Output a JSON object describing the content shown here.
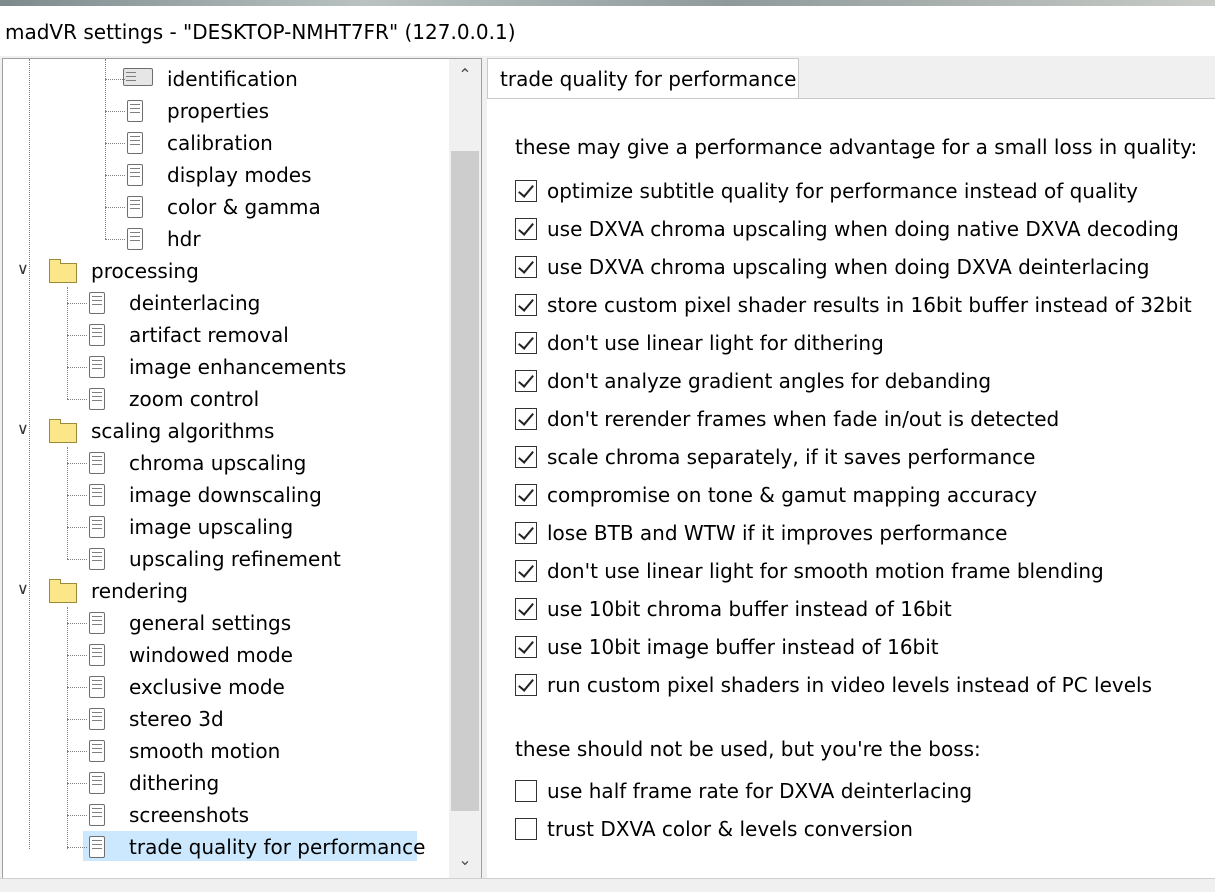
{
  "window": {
    "title": "madVR settings - \"DESKTOP-NMHT7FR\" (127.0.0.1)"
  },
  "tree": {
    "items": [
      {
        "label": "identification",
        "level": 2,
        "icon": "identification-icon"
      },
      {
        "label": "properties",
        "level": 2,
        "icon": "page-icon"
      },
      {
        "label": "calibration",
        "level": 2,
        "icon": "page-icon"
      },
      {
        "label": "display modes",
        "level": 2,
        "icon": "page-icon"
      },
      {
        "label": "color & gamma",
        "level": 2,
        "icon": "page-icon"
      },
      {
        "label": "hdr",
        "level": 2,
        "icon": "page-icon"
      },
      {
        "label": "processing",
        "level": 0,
        "icon": "folder-icon"
      },
      {
        "label": "deinterlacing",
        "level": 1,
        "icon": "page-icon"
      },
      {
        "label": "artifact removal",
        "level": 1,
        "icon": "page-icon"
      },
      {
        "label": "image enhancements",
        "level": 1,
        "icon": "page-icon"
      },
      {
        "label": "zoom control",
        "level": 1,
        "icon": "page-icon"
      },
      {
        "label": "scaling algorithms",
        "level": 0,
        "icon": "folder-icon"
      },
      {
        "label": "chroma upscaling",
        "level": 1,
        "icon": "page-icon"
      },
      {
        "label": "image downscaling",
        "level": 1,
        "icon": "page-icon"
      },
      {
        "label": "image upscaling",
        "level": 1,
        "icon": "page-icon"
      },
      {
        "label": "upscaling refinement",
        "level": 1,
        "icon": "page-icon"
      },
      {
        "label": "rendering",
        "level": 0,
        "icon": "folder-icon"
      },
      {
        "label": "general settings",
        "level": 1,
        "icon": "page-icon"
      },
      {
        "label": "windowed mode",
        "level": 1,
        "icon": "page-icon"
      },
      {
        "label": "exclusive mode",
        "level": 1,
        "icon": "page-icon"
      },
      {
        "label": "stereo 3d",
        "level": 1,
        "icon": "page-icon"
      },
      {
        "label": "smooth motion",
        "level": 1,
        "icon": "page-icon"
      },
      {
        "label": "dithering",
        "level": 1,
        "icon": "page-icon"
      },
      {
        "label": "screenshots",
        "level": 1,
        "icon": "page-icon"
      },
      {
        "label": "trade quality for performance",
        "level": 1,
        "icon": "page-icon",
        "selected": true
      }
    ]
  },
  "tab": {
    "label": "trade quality for performance"
  },
  "section1": {
    "heading": "these may give a performance advantage for a small loss in quality:",
    "options": [
      {
        "label": "optimize subtitle quality for performance instead of quality",
        "checked": true
      },
      {
        "label": "use DXVA chroma upscaling when doing native DXVA decoding",
        "checked": true
      },
      {
        "label": "use DXVA chroma upscaling when doing DXVA deinterlacing",
        "checked": true
      },
      {
        "label": "store custom pixel shader results in 16bit buffer instead of 32bit",
        "checked": true
      },
      {
        "label": "don't use linear light for dithering",
        "checked": true
      },
      {
        "label": "don't analyze gradient angles for debanding",
        "checked": true
      },
      {
        "label": "don't rerender frames when fade in/out is detected",
        "checked": true
      },
      {
        "label": "scale chroma separately, if it saves performance",
        "checked": true
      },
      {
        "label": "compromise on tone & gamut mapping accuracy",
        "checked": true
      },
      {
        "label": "lose BTB and WTW if it improves performance",
        "checked": true
      },
      {
        "label": "don't use linear light for smooth motion frame blending",
        "checked": true
      },
      {
        "label": "use 10bit chroma buffer instead of 16bit",
        "checked": true
      },
      {
        "label": "use 10bit image buffer instead of 16bit",
        "checked": true
      },
      {
        "label": "run custom pixel shaders in video levels instead of PC levels",
        "checked": true
      }
    ]
  },
  "section2": {
    "heading": "these should not be used, but you're the boss:",
    "options": [
      {
        "label": "use half frame rate for DXVA deinterlacing",
        "checked": false
      },
      {
        "label": "trust DXVA color & levels conversion",
        "checked": false
      }
    ]
  }
}
